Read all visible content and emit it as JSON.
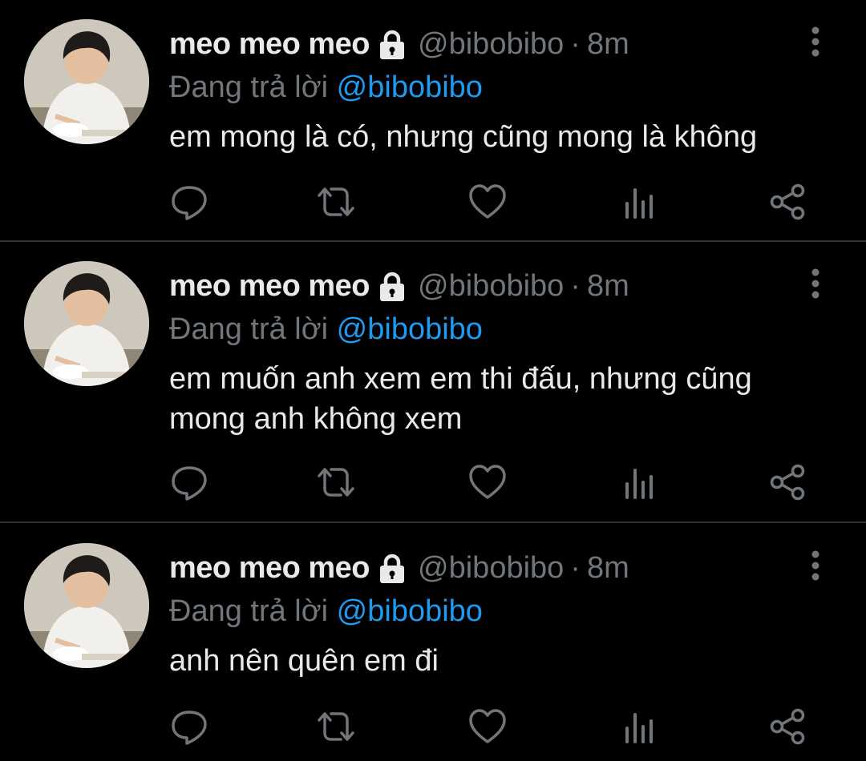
{
  "colors": {
    "background": "#000000",
    "primary_text": "#e7e9ea",
    "secondary_text": "#71767b",
    "link": "#1d9bf0",
    "divider": "#2f3336"
  },
  "icons": {
    "lock": "lock-icon",
    "more": "more-vertical-icon",
    "reply": "reply-bubble-icon",
    "retweet": "retweet-icon",
    "like": "heart-icon",
    "views": "bar-chart-icon",
    "share": "share-icon"
  },
  "tweets": [
    {
      "display_name": "meo meo meo",
      "handle": "@bibobibo",
      "separator": "·",
      "time": "8m",
      "replying_prefix": "Đang trả lời",
      "replying_handle": "@bibobibo",
      "text": "em mong là có, nhưng cũng mong là không"
    },
    {
      "display_name": "meo meo meo",
      "handle": "@bibobibo",
      "separator": "·",
      "time": "8m",
      "replying_prefix": "Đang trả lời",
      "replying_handle": "@bibobibo",
      "text": "em muốn anh xem em thi đấu, nhưng cũng mong anh không xem"
    },
    {
      "display_name": "meo meo meo",
      "handle": "@bibobibo",
      "separator": "·",
      "time": "8m",
      "replying_prefix": "Đang trả lời",
      "replying_handle": "@bibobibo",
      "text": "anh nên quên em đi"
    }
  ]
}
